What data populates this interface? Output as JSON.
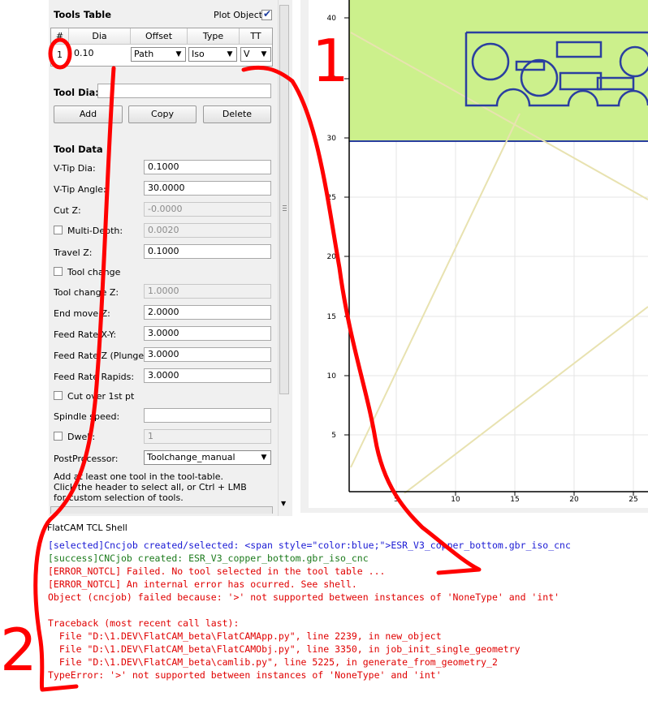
{
  "tools_table": {
    "title": "Tools Table",
    "plot_object_label": "Plot Object",
    "headers": [
      "#",
      "Dia",
      "Offset",
      "Type",
      "TT"
    ],
    "row": {
      "num": "1",
      "dia": "0.10",
      "offset": "Path",
      "type": "Iso",
      "tt": "V"
    }
  },
  "tool_dia": {
    "label": "Tool Dia:",
    "value": ""
  },
  "buttons": {
    "add": "Add",
    "copy": "Copy",
    "delete": "Delete"
  },
  "tool_data": {
    "title": "Tool Data",
    "vtip_dia": {
      "label": "V-Tip Dia:",
      "value": "0.1000"
    },
    "vtip_angle": {
      "label": "V-Tip Angle:",
      "value": "30.0000"
    },
    "cut_z": {
      "label": "Cut Z:",
      "value": "-0.0000"
    },
    "multi_depth": {
      "label": "Multi-Depth:",
      "value": "0.0020"
    },
    "travel_z": {
      "label": "Travel Z:",
      "value": "0.1000"
    },
    "tool_change": {
      "label": "Tool change"
    },
    "tool_change_z": {
      "label": "Tool change Z:",
      "value": "1.0000"
    },
    "end_move_z": {
      "label": "End move Z:",
      "value": "2.0000"
    },
    "feed_xy": {
      "label": "Feed Rate X-Y:",
      "value": "3.0000"
    },
    "feed_z": {
      "label": "Feed Rate Z (Plunge):",
      "value": "3.0000"
    },
    "feed_rapids": {
      "label": "Feed Rate Rapids:",
      "value": "3.0000"
    },
    "cut_over": {
      "label": "Cut over 1st pt"
    },
    "spindle": {
      "label": "Spindle speed:",
      "value": ""
    },
    "dwell": {
      "label": "Dwell:",
      "value": "1"
    },
    "postproc": {
      "label": "PostProcessor:",
      "value": "Toolchange_manual"
    },
    "hint_1": "Add at least one tool in the tool-table.",
    "hint_2": "Click the header to select all, or Ctrl + LMB",
    "hint_3": "for custom selection of tools."
  },
  "plot": {
    "y_ticks": [
      "40",
      "35",
      "30",
      "25",
      "20",
      "15",
      "10",
      "5"
    ],
    "x_ticks": [
      "5",
      "10",
      "15",
      "20",
      "25"
    ],
    "colors": {
      "board_fill": "#ccf08c",
      "outline": "#2b3fa0",
      "axis": "#000000",
      "grid": "#e6e6e6"
    }
  },
  "shell": {
    "title": "FlatCAM TCL Shell",
    "lines": [
      {
        "text": "[selected]Cncjob created/selected: <span style=\"color:blue;\">ESR_V3_copper_bottom.gbr_iso_cnc",
        "color": "#1a1ad4"
      },
      {
        "text": "[success]CNCjob created: ESR_V3_copper_bottom.gbr_iso_cnc",
        "color": "#1b7a1b"
      },
      {
        "text": "[ERROR_NOTCL] Failed. No tool selected in the tool table ...",
        "color": "#e00000"
      },
      {
        "text": "[ERROR_NOTCL] An internal error has ocurred. See shell.",
        "color": "#e00000"
      },
      {
        "text": "Object (cncjob) failed because: '>' not supported between instances of 'NoneType' and 'int'",
        "color": "#e00000"
      },
      {
        "text": "",
        "color": "#e00000"
      },
      {
        "text": "Traceback (most recent call last):",
        "color": "#e00000"
      },
      {
        "text": "  File \"D:\\1.DEV\\FlatCAM_beta\\FlatCAMApp.py\", line 2239, in new_object",
        "color": "#e00000"
      },
      {
        "text": "  File \"D:\\1.DEV\\FlatCAM_beta\\FlatCAMObj.py\", line 3350, in job_init_single_geometry",
        "color": "#e00000"
      },
      {
        "text": "  File \"D:\\1.DEV\\FlatCAM_beta\\camlib.py\", line 5225, in generate_from_geometry_2",
        "color": "#e00000"
      },
      {
        "text": "TypeError: '>' not supported between instances of 'NoneType' and 'int'",
        "color": "#e00000"
      }
    ]
  },
  "annotations": {
    "label_1": "1",
    "label_2": "2",
    "color": "#ff0000"
  }
}
